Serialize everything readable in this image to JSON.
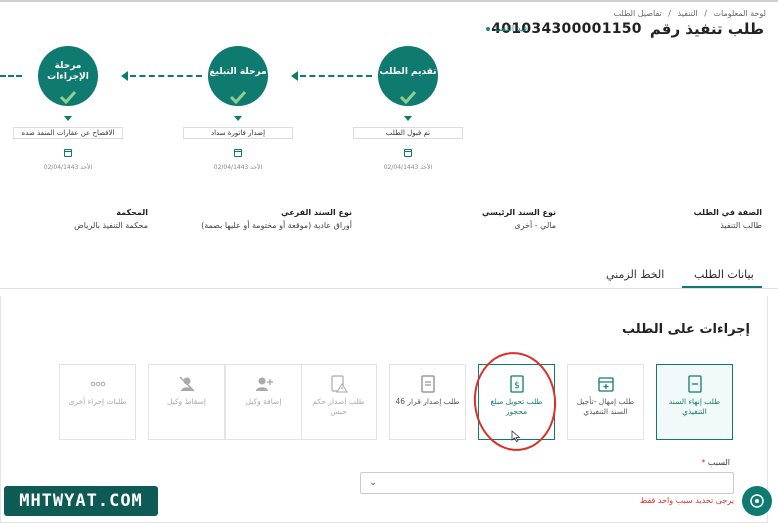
{
  "breadcrumb": [
    "لوحة المعلومات",
    "/",
    "التنفيذ",
    "/",
    "تفاصيل الطلب"
  ],
  "header": {
    "title": "طلب تنفيذ رقم",
    "request_number": "401034300001150",
    "status": "قيد التنفيذ"
  },
  "steps": [
    {
      "title": "تقديم الطلب",
      "status": "تم قبول الطلب",
      "date": "الأحد 02/04/1443"
    },
    {
      "title": "مرحلة التبليغ",
      "status": "إصدار فاتورة سداد",
      "date": "الأحد 02/04/1443"
    },
    {
      "title": "مرحلة الإجراءات",
      "status": "الافصاح عن عقارات المنفذ ضده",
      "date": "الأحد 02/04/1443"
    }
  ],
  "info": [
    {
      "label": "الصفة في الطلب",
      "value": "طالب التنفيذ"
    },
    {
      "label": "نوع السند الرئيسي",
      "value": "مالي - أخرى"
    },
    {
      "label": "نوع السند الفرعي",
      "value": "أوراق عادية (موقعة أو مختومة أو عليها بصمة)"
    },
    {
      "label": "المحكمة",
      "value": "محكمة التنفيذ بالرياض"
    }
  ],
  "tabs": [
    "بيانات الطلب",
    "الخط الزمني"
  ],
  "actions": {
    "title": "إجراءات على الطلب",
    "cards": [
      {
        "label": "طلب إنهاء السند التنفيذي",
        "icon": "document-minus-icon"
      },
      {
        "label": "طلب إمهال -تأجيل السند التنفيذي",
        "icon": "calendar-plus-icon"
      },
      {
        "label": "طلب تحويل مبلغ محجوز",
        "icon": "money-document-icon"
      },
      {
        "label": "طلب إصدار قرار 46",
        "icon": "document-icon"
      },
      {
        "label": "طلب إصدار حكم حبس",
        "icon": "warning-document-icon"
      },
      {
        "label": "إضافة وكيل",
        "icon": "add-user-icon"
      },
      {
        "label": "إسقاط وكيل",
        "icon": "remove-user-icon"
      },
      {
        "label": "طلبات إجراء أخرى",
        "icon": "more-icon"
      }
    ]
  },
  "reason": {
    "label": "السبب",
    "required_mark": "*",
    "error": "يرجى تحديد سبب واحد فقط"
  },
  "watermark": "MHTWYAT.COM",
  "colors": {
    "accent": "#0f7a6f",
    "error": "#d9302c"
  }
}
